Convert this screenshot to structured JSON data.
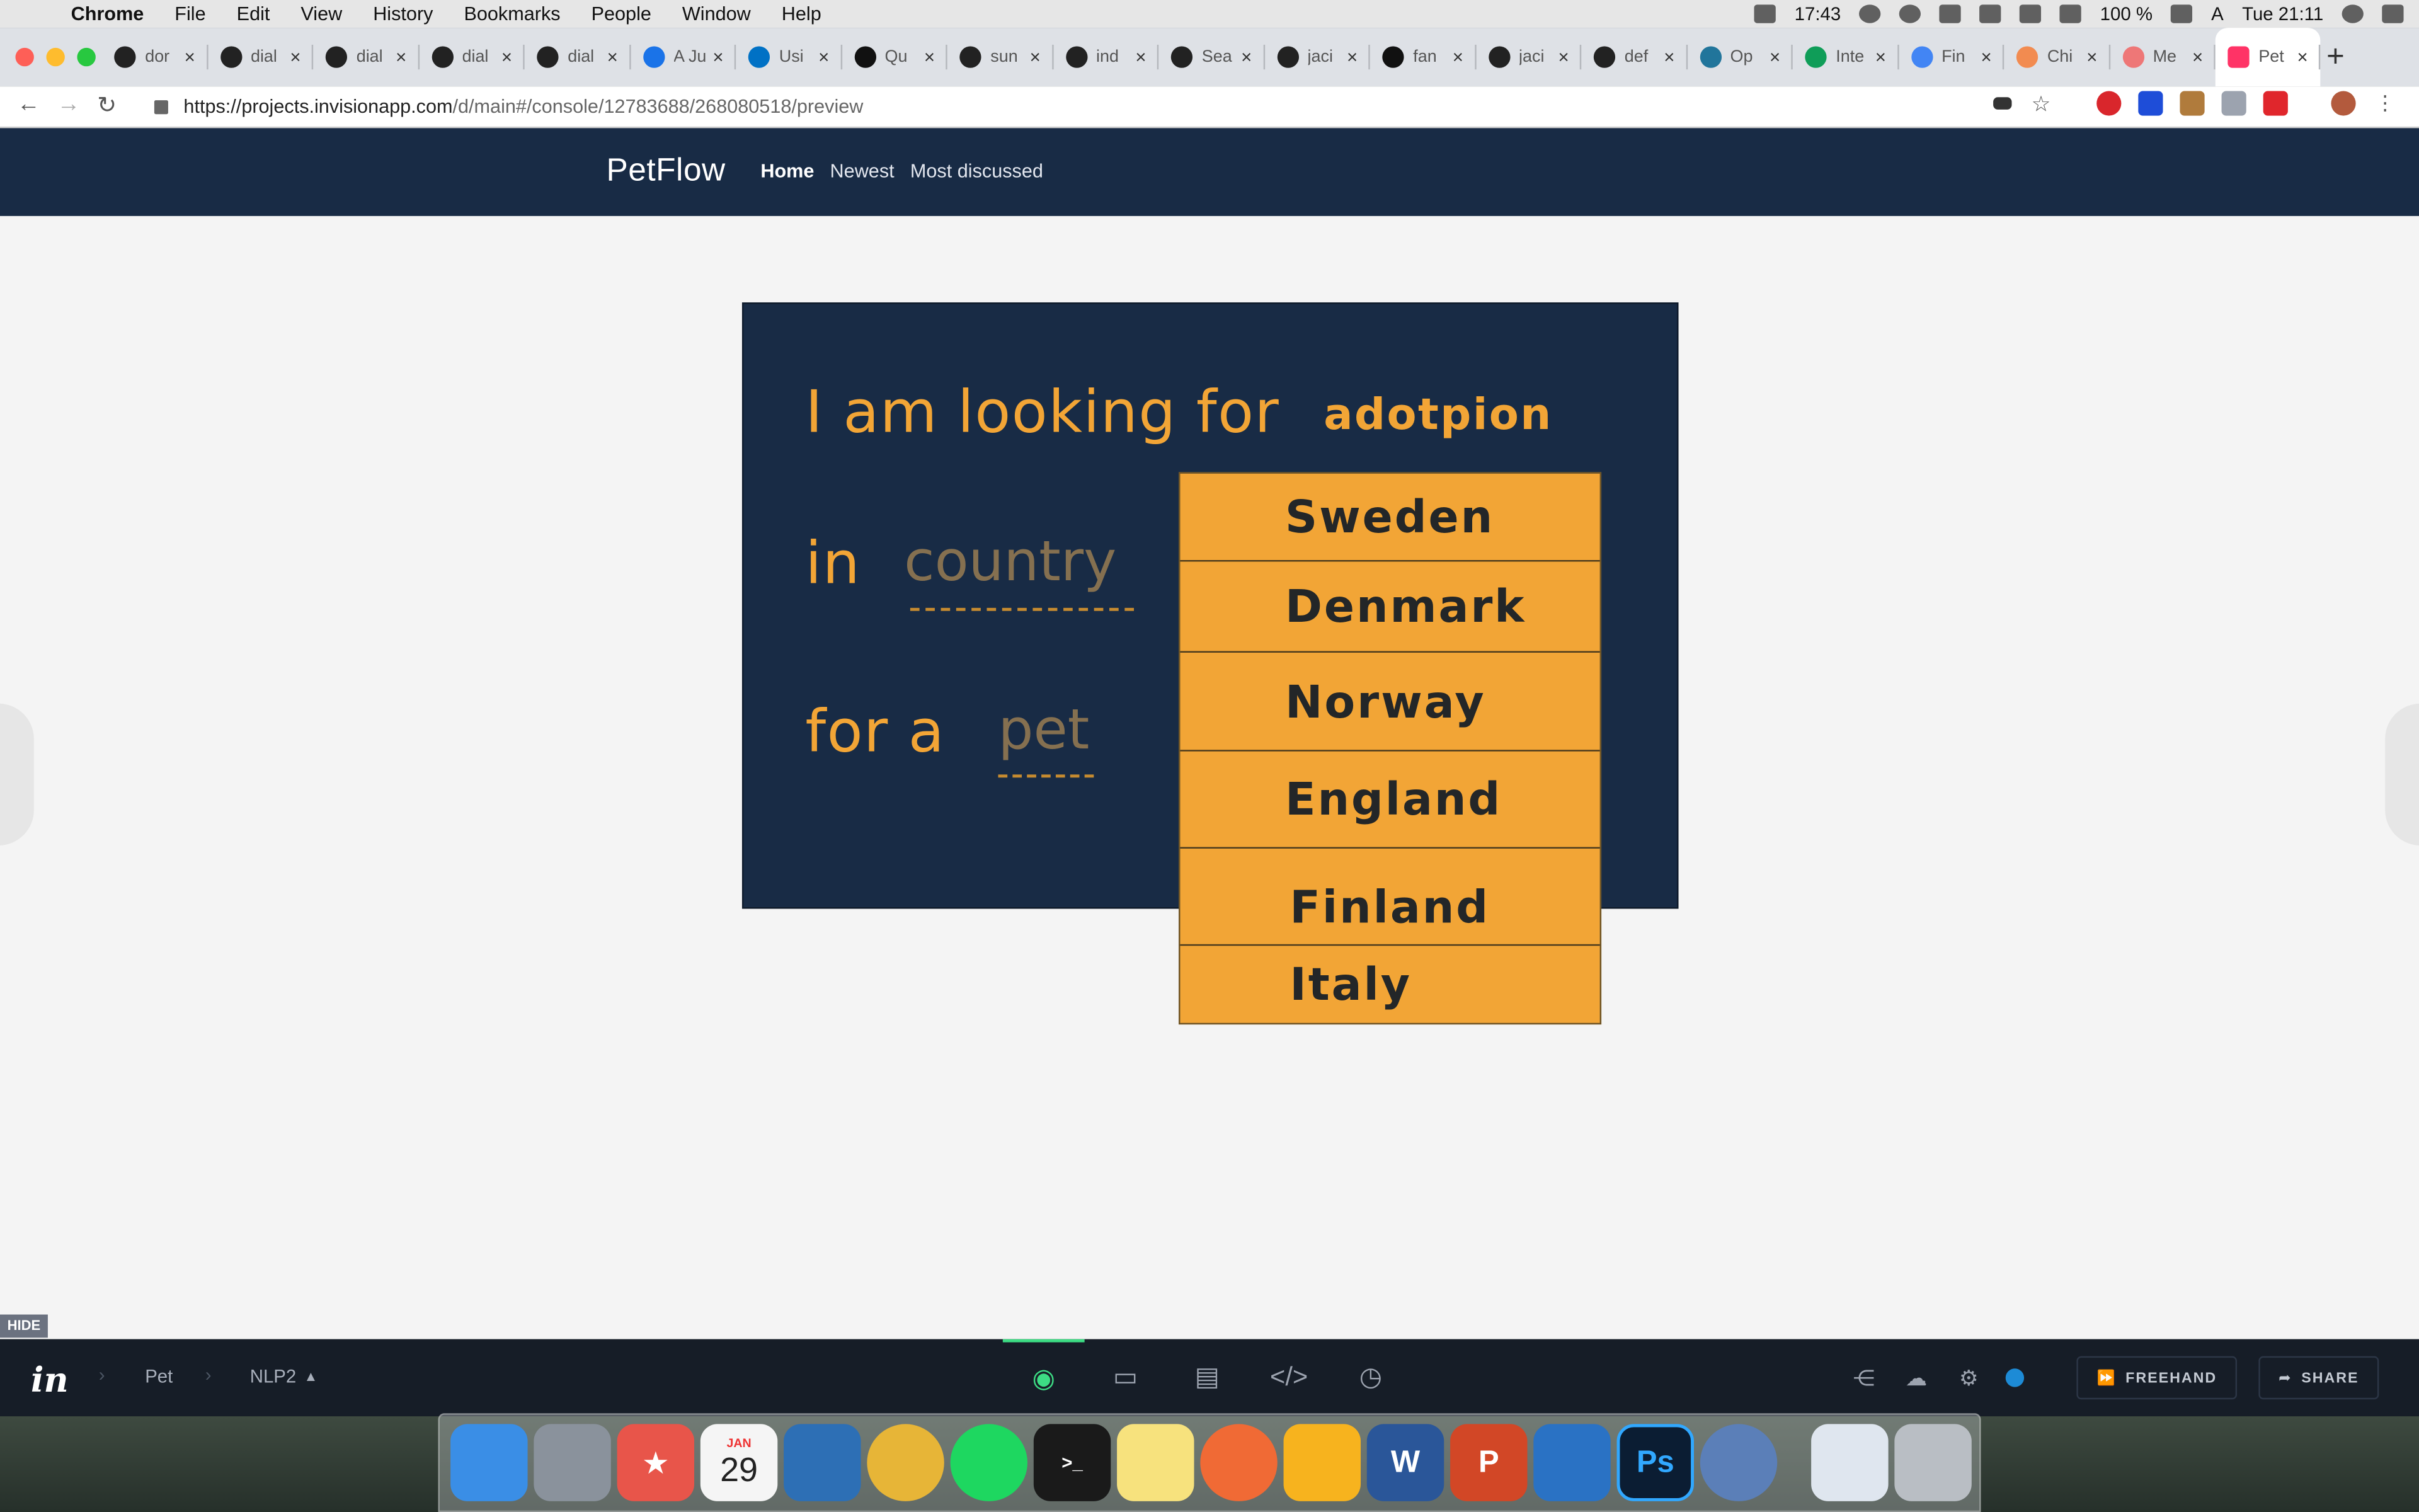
{
  "menubar": {
    "app": "Chrome",
    "menus": [
      "File",
      "Edit",
      "View",
      "History",
      "Bookmarks",
      "People",
      "Window",
      "Help"
    ],
    "time_left": "17:43",
    "battery": "100 %",
    "input": "A",
    "clock": "Tue 21:11"
  },
  "tabs": [
    {
      "label": "dor",
      "icon": "github-icon"
    },
    {
      "label": "dial",
      "icon": "github-icon"
    },
    {
      "label": "dial",
      "icon": "github-icon"
    },
    {
      "label": "dial",
      "icon": "github-icon"
    },
    {
      "label": "dial",
      "icon": "github-icon"
    },
    {
      "label": "A Ju",
      "icon": "triangle-icon"
    },
    {
      "label": "Usi",
      "icon": "intel-icon"
    },
    {
      "label": "Qu",
      "icon": "medium-icon"
    },
    {
      "label": "sun",
      "icon": "github-icon"
    },
    {
      "label": "ind",
      "icon": "github-icon"
    },
    {
      "label": "Sea",
      "icon": "github-icon"
    },
    {
      "label": "jaci",
      "icon": "github-icon"
    },
    {
      "label": "fan",
      "icon": "stack-icon"
    },
    {
      "label": "jaci",
      "icon": "github-icon"
    },
    {
      "label": "def",
      "icon": "github-icon"
    },
    {
      "label": "Op",
      "icon": "wordpress-icon"
    },
    {
      "label": "Inte",
      "icon": "sheets-icon"
    },
    {
      "label": "Fin",
      "icon": "docs-icon"
    },
    {
      "label": "Chi",
      "icon": "chi-icon"
    },
    {
      "label": "Me",
      "icon": "me-icon"
    },
    {
      "label": "Pet",
      "icon": "invision-icon",
      "active": true
    }
  ],
  "address": {
    "host": "https://projects.invisionapp.com",
    "path": "/d/main#/console/12783688/268080518/preview"
  },
  "site": {
    "brand": "PetFlow",
    "nav": [
      "Home",
      "Newest",
      "Most discussed"
    ]
  },
  "form": {
    "line1": "I am looking for",
    "line1_value": "adotpion",
    "line2": "in",
    "line2_placeholder": "country",
    "line3": "for a",
    "line3_placeholder": "pet"
  },
  "dropdown": {
    "options": [
      "Sweden",
      "Denmark",
      "Norway",
      "England",
      "Finland",
      "Italy"
    ]
  },
  "invision": {
    "hide": "HIDE",
    "crumbs": [
      "Pet",
      "NLP2"
    ],
    "tools": [
      "preview-eye-icon",
      "build-icon",
      "comment-icon",
      "inspect-code-icon",
      "history-clock-icon"
    ],
    "freehand": "FREEHAND",
    "share": "SHARE"
  },
  "dock": {
    "calendar_month": "JAN",
    "calendar_day": "29"
  },
  "colors": {
    "site_navy": "#182b45",
    "accent_orange": "#f2a536"
  }
}
